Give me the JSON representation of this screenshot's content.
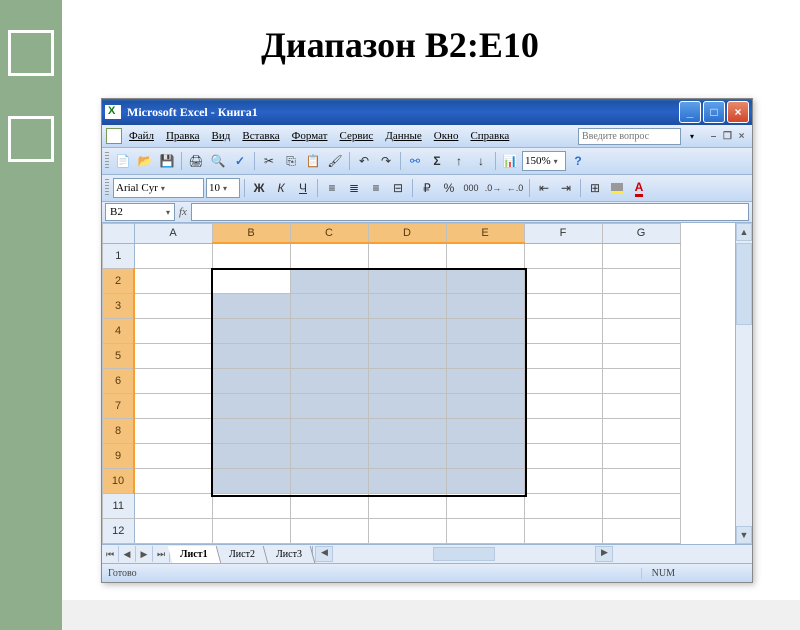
{
  "slide": {
    "title": "Диапазон В2:Е10"
  },
  "window": {
    "app_title": "Microsoft Excel - Книга1",
    "minimize": "_",
    "maximize": "□",
    "close": "×"
  },
  "menu": {
    "file": "Файл",
    "edit": "Правка",
    "view": "Вид",
    "insert": "Вставка",
    "format": "Формат",
    "tools": "Сервис",
    "data": "Данные",
    "window": "Окно",
    "help": "Справка",
    "question_placeholder": "Введите вопрос"
  },
  "doc_window": {
    "minimize": "–",
    "restore": "❐",
    "close": "×"
  },
  "toolbar": {
    "font_family": "Arial Cyr",
    "font_size": "10",
    "zoom": "150%",
    "bold": "Ж",
    "italic": "К",
    "underline": "Ч",
    "currency": "₽",
    "percent": "%",
    "thousands": "000",
    "sum": "Σ",
    "sort_asc": "↑",
    "sort_desc": "↓"
  },
  "formula_bar": {
    "name_box": "B2",
    "fx": "fx"
  },
  "columns": [
    "A",
    "B",
    "C",
    "D",
    "E",
    "F",
    "G"
  ],
  "rows_shown": 12,
  "selection": {
    "range": "B2:E10",
    "anchor": "B2",
    "col_start": "B",
    "col_end": "E",
    "row_start": 2,
    "row_end": 10
  },
  "sheets": {
    "navs": [
      "⏮",
      "◀",
      "▶",
      "⏭"
    ],
    "tabs": [
      "Лист1",
      "Лист2",
      "Лист3"
    ],
    "active": 0
  },
  "status": {
    "ready": "Готово",
    "num": "NUM"
  }
}
